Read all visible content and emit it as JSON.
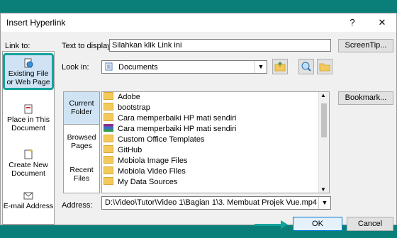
{
  "window": {
    "title": "Insert Hyperlink",
    "help_label": "?",
    "close_label": "✕"
  },
  "link_to": {
    "label": "Link to:",
    "items": [
      {
        "label": "Existing File or Web Page",
        "icon": "globe-file-icon"
      },
      {
        "label": "Place in This Document",
        "icon": "document-place-icon"
      },
      {
        "label": "Create New Document",
        "icon": "new-document-icon"
      },
      {
        "label": "E-mail Address",
        "icon": "email-icon"
      }
    ]
  },
  "text_to_display": {
    "label": "Text to display:",
    "value": "Silahkan klik Link ini"
  },
  "screentip_label": "ScreenTip...",
  "look_in": {
    "label": "Look in:",
    "value": "Documents"
  },
  "sidebar": [
    "Current Folder",
    "Browsed Pages",
    "Recent Files"
  ],
  "files": [
    {
      "name": "Adobe",
      "type": "folder"
    },
    {
      "name": "bootstrap",
      "type": "folder"
    },
    {
      "name": "Cara memperbaiki HP mati sendiri",
      "type": "folder"
    },
    {
      "name": "Cara memperbaiki HP mati sendiri",
      "type": "archive"
    },
    {
      "name": "Custom Office Templates",
      "type": "folder"
    },
    {
      "name": "GitHub",
      "type": "folder"
    },
    {
      "name": "Mobiola Image Files",
      "type": "folder"
    },
    {
      "name": "Mobiola Video Files",
      "type": "folder"
    },
    {
      "name": "My Data Sources",
      "type": "folder"
    }
  ],
  "bookmark_label": "Bookmark...",
  "address": {
    "label": "Address:",
    "value": "D:\\Video\\Tutor\\Video 1\\Bagian 1\\3. Membuat Projek Vue.mp4"
  },
  "ok_label": "OK",
  "cancel_label": "Cancel",
  "colors": {
    "accent": "#14a29b",
    "background": "#0a7f7a"
  }
}
